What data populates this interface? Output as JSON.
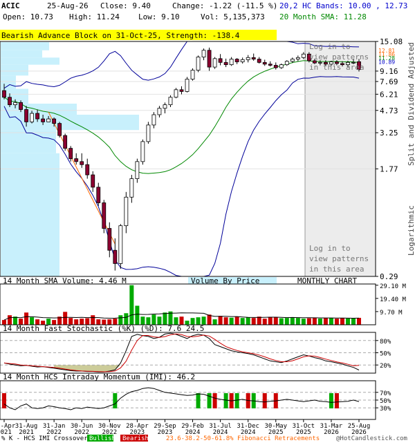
{
  "header": {
    "ticker": "ACIC",
    "date": "25-Aug-26",
    "close": "Close: 9.40",
    "change": "Change: -1.22 (-11.5 %)",
    "open": "Open: 10.73",
    "high": "High: 11.24",
    "low": "Low: 9.10",
    "vol": "Vol: 5,135,373",
    "hc_bands": "20,2 HC Bands: 10.00 , 12.73",
    "sma_label": "20 Month SMA: 11.28"
  },
  "banner": "Bearish Advance Block on 31-Oct-25, Strength: -138.4",
  "login": {
    "top": [
      "Log in to",
      "view patterns",
      "in this area"
    ],
    "bottom": [
      "Log in to",
      "view patterns",
      "in this area"
    ]
  },
  "price_axis": {
    "ticks": [
      "15.08",
      "9.16",
      "7.69",
      "6.21",
      "4.73",
      "3.25",
      "1.77",
      "0.29"
    ],
    "values": [
      15.08,
      9.16,
      7.69,
      6.21,
      4.73,
      3.25,
      1.77,
      0.29
    ],
    "right_label_top": "Split and Dividend Adjusted",
    "right_label_bottom": "Logarithmic",
    "cluster": [
      "12.81",
      "11.86",
      "11.28",
      "10.89"
    ]
  },
  "volume_panel": {
    "title": "14 Month SMA Volume: 4.46 M",
    "vbp": "Volume By Price",
    "chart_type": "MONTHLY CHART",
    "ticks": [
      "29.10 M",
      "19.40 M",
      "9.70 M"
    ]
  },
  "stoch_panel": {
    "title": "14 Month Fast Stochastic (%K) (%D): 7.6    24.5",
    "ticks": [
      "80%",
      "50%",
      "20%"
    ]
  },
  "imi_panel": {
    "title": "14 Month HCS Intraday Momentum (IMI): 46.2",
    "ticks": [
      "70%",
      "50%",
      "30%"
    ]
  },
  "x_axis": {
    "labels": [
      [
        "30-Apr",
        "2021"
      ],
      [
        "31-Aug",
        "2021"
      ],
      [
        "31-Jan",
        "2022"
      ],
      [
        "30-Jun",
        "2022"
      ],
      [
        "30-Nov",
        "2022"
      ],
      [
        "28-Apr",
        "2023"
      ],
      [
        "29-Sep",
        "2023"
      ],
      [
        "29-Feb",
        "2024"
      ],
      [
        "31-Jul",
        "2024"
      ],
      [
        "31-Dec",
        "2024"
      ],
      [
        "30-May",
        "2025"
      ],
      [
        "31-Oct",
        "2025"
      ],
      [
        "31-Mar",
        "2026"
      ],
      [
        "25-Aug",
        "2026"
      ]
    ]
  },
  "footer": {
    "legend_prefix": "% K - HCS IMI Crossover,",
    "bullish": "Bullish",
    "bearish": "Bearish",
    "fib": "23.6-38.2-50-61.8% Fibonacci Retracements",
    "brand": "@HotCandlestick.com"
  },
  "colors": {
    "up": "#00aa00",
    "down": "#cc0000",
    "candle_up": "#ffffff",
    "candle_down": "#8b0030",
    "sma": "#008800",
    "band": "#000099",
    "vbp": "#c8f0fc",
    "banner": "#ffff00"
  },
  "chart_data": {
    "type": "candlestick",
    "title": "ACIC",
    "ylabel": "Split and Dividend Adjusted",
    "scale": "log",
    "ylim": [
      0.29,
      15.08
    ],
    "months": [
      "Apr-21",
      "May-21",
      "Jun-21",
      "Jul-21",
      "Aug-21",
      "Sep-21",
      "Oct-21",
      "Nov-21",
      "Dec-21",
      "Jan-22",
      "Feb-22",
      "Mar-22",
      "Apr-22",
      "May-22",
      "Jun-22",
      "Jul-22",
      "Aug-22",
      "Sep-22",
      "Oct-22",
      "Nov-22",
      "Dec-22",
      "Jan-23",
      "Feb-23",
      "Mar-23",
      "Apr-23",
      "May-23",
      "Jun-23",
      "Jul-23",
      "Aug-23",
      "Sep-23",
      "Oct-23",
      "Nov-23",
      "Dec-23",
      "Jan-24",
      "Feb-24",
      "Mar-24",
      "Apr-24",
      "May-24",
      "Jun-24",
      "Jul-24",
      "Aug-24",
      "Sep-24",
      "Oct-24",
      "Nov-24",
      "Dec-24",
      "Jan-25",
      "Feb-25",
      "Mar-25",
      "Apr-25",
      "May-25",
      "Jun-25",
      "Jul-25",
      "Aug-25",
      "Sep-25",
      "Oct-25",
      "Nov-25",
      "Dec-25",
      "Jan-26",
      "Feb-26",
      "Mar-26",
      "Apr-26",
      "May-26",
      "Jun-26",
      "Jul-26",
      "Aug-26"
    ],
    "ohlc": [
      [
        6.6,
        7.4,
        5.7,
        5.9
      ],
      [
        5.9,
        6.3,
        5.0,
        5.2
      ],
      [
        5.2,
        5.7,
        4.9,
        5.4
      ],
      [
        5.4,
        5.6,
        4.6,
        4.8
      ],
      [
        4.8,
        5.1,
        3.6,
        3.9
      ],
      [
        3.9,
        4.7,
        3.8,
        4.5
      ],
      [
        4.5,
        4.8,
        3.9,
        4.1
      ],
      [
        4.1,
        4.4,
        3.7,
        3.9
      ],
      [
        3.9,
        4.3,
        3.9,
        4.1
      ],
      [
        4.1,
        4.2,
        3.6,
        3.8
      ],
      [
        3.8,
        3.9,
        3.0,
        3.1
      ],
      [
        3.1,
        3.2,
        2.4,
        2.5
      ],
      [
        2.5,
        2.6,
        2.0,
        2.1
      ],
      [
        2.1,
        2.3,
        1.9,
        2.0
      ],
      [
        2.0,
        2.3,
        1.8,
        1.9
      ],
      [
        1.9,
        2.1,
        1.5,
        1.6
      ],
      [
        1.6,
        1.7,
        1.2,
        1.3
      ],
      [
        1.3,
        1.4,
        0.95,
        1.0
      ],
      [
        1.0,
        1.05,
        0.6,
        0.65
      ],
      [
        0.65,
        0.72,
        0.4,
        0.45
      ],
      [
        0.45,
        0.55,
        0.32,
        0.36
      ],
      [
        0.36,
        0.7,
        0.33,
        0.68
      ],
      [
        0.68,
        1.2,
        0.6,
        1.1
      ],
      [
        1.1,
        1.6,
        1.0,
        1.5
      ],
      [
        1.5,
        2.1,
        1.4,
        2.0
      ],
      [
        2.0,
        2.9,
        1.9,
        2.8
      ],
      [
        2.8,
        3.9,
        2.7,
        3.7
      ],
      [
        3.7,
        4.6,
        3.5,
        4.4
      ],
      [
        4.4,
        5.1,
        4.2,
        4.9
      ],
      [
        4.9,
        5.4,
        4.5,
        5.2
      ],
      [
        5.2,
        6.1,
        5.0,
        5.9
      ],
      [
        5.9,
        6.9,
        5.8,
        6.7
      ],
      [
        6.7,
        7.1,
        6.2,
        6.5
      ],
      [
        6.5,
        8.3,
        6.4,
        8.0
      ],
      [
        8.0,
        9.6,
        7.8,
        9.3
      ],
      [
        9.3,
        11.9,
        9.0,
        11.6
      ],
      [
        11.6,
        13.4,
        11.0,
        13.0
      ],
      [
        13.0,
        13.6,
        9.2,
        9.8
      ],
      [
        9.8,
        11.6,
        9.5,
        11.3
      ],
      [
        11.3,
        12.2,
        10.1,
        10.6
      ],
      [
        10.6,
        11.3,
        9.8,
        10.2
      ],
      [
        10.2,
        11.6,
        10.0,
        11.2
      ],
      [
        11.2,
        11.4,
        10.3,
        10.7
      ],
      [
        10.7,
        11.5,
        10.4,
        11.1
      ],
      [
        11.1,
        12.0,
        10.6,
        11.5
      ],
      [
        11.5,
        12.3,
        10.9,
        11.2
      ],
      [
        11.2,
        11.6,
        10.4,
        10.6
      ],
      [
        10.6,
        11.1,
        10.0,
        10.3
      ],
      [
        10.3,
        10.8,
        9.9,
        10.1
      ],
      [
        10.1,
        10.6,
        9.4,
        9.7
      ],
      [
        9.7,
        10.4,
        9.5,
        10.2
      ],
      [
        10.2,
        11.0,
        10.0,
        10.8
      ],
      [
        10.8,
        11.5,
        10.5,
        11.2
      ],
      [
        11.2,
        11.9,
        10.8,
        11.5
      ],
      [
        11.5,
        12.6,
        11.2,
        12.2
      ],
      [
        12.2,
        12.6,
        10.6,
        10.9
      ],
      [
        10.9,
        11.3,
        10.3,
        10.5
      ],
      [
        10.5,
        11.0,
        10.1,
        10.6
      ],
      [
        10.6,
        11.0,
        10.0,
        10.3
      ],
      [
        10.3,
        10.9,
        10.0,
        10.7
      ],
      [
        10.7,
        11.0,
        10.1,
        10.4
      ],
      [
        10.4,
        10.8,
        9.9,
        10.2
      ],
      [
        10.2,
        10.9,
        9.8,
        10.6
      ],
      [
        10.6,
        11.3,
        10.3,
        10.6
      ],
      [
        10.73,
        11.24,
        9.1,
        9.4
      ]
    ]
  }
}
